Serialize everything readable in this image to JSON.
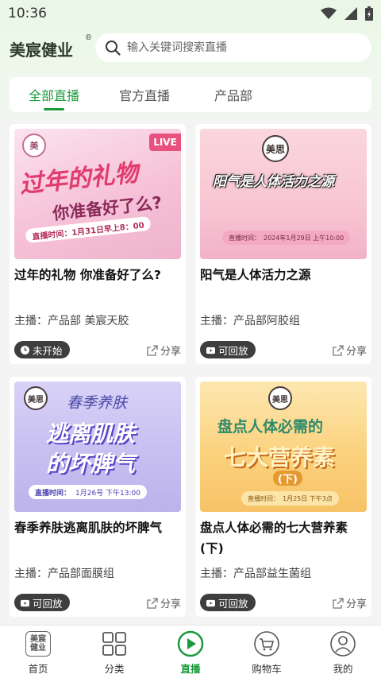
{
  "status_bar": {
    "time": "10:36"
  },
  "header": {
    "brand": "美宸健业",
    "brand_mark": "®",
    "search_placeholder": "输入关键词搜索直播"
  },
  "tabs": [
    {
      "label": "全部直播",
      "active": true
    },
    {
      "label": "官方直播",
      "active": false
    },
    {
      "label": "产品部",
      "active": false
    }
  ],
  "cards": [
    {
      "title": "过年的礼物 你准备好了么?",
      "host": "主播：产品部 美宸天胶",
      "status": "未开始",
      "share": "分享",
      "thumb": {
        "live_tag": "LIVE",
        "line1": "过年的礼物",
        "line2": "你准备好了么?",
        "schedule": "直播时间：1月31日早上8：00",
        "bg": "#f7cfe0"
      }
    },
    {
      "title": "阳气是人体活力之源",
      "host": "主播：产品部阿胶组",
      "status": "可回放",
      "share": "分享",
      "thumb": {
        "logo": "美思",
        "line1": "阳气是人体活力之源",
        "schedule_label": "直播时间：",
        "schedule": "2024年1月29日 上午10:00",
        "bg": "#f9cfda"
      }
    },
    {
      "title": "春季养肤逃离肌肤的坏脾气",
      "host": "主播：产品部面膜组",
      "status": "可回放",
      "share": "分享",
      "thumb": {
        "logo": "美思",
        "line0": "春季养肤",
        "line1": "逃离肌肤",
        "line2": "的坏脾气",
        "schedule_label": "直播时间：",
        "schedule": "1月26号 下午13:00",
        "bg": "#cfc6f3"
      }
    },
    {
      "title": "盘点人体必需的七大营养素(下)",
      "host": "主播：产品部益生菌组",
      "status": "可回放",
      "share": "分享",
      "thumb": {
        "logo": "美思",
        "line1": "盘点人体必需的",
        "line2": "七大营养素",
        "line3": "(下)",
        "schedule_label": "直播时间：",
        "schedule": "1月25日 下午3点",
        "bg": "#fbd98a"
      }
    }
  ],
  "bottom_nav": [
    {
      "label": "首页",
      "icon": "home-logo-icon",
      "logo_text": "美宸健业"
    },
    {
      "label": "分类",
      "icon": "grid-icon"
    },
    {
      "label": "直播",
      "icon": "play-circle-icon",
      "active": true
    },
    {
      "label": "购物车",
      "icon": "cart-icon"
    },
    {
      "label": "我的",
      "icon": "user-icon"
    }
  ],
  "colors": {
    "accent": "#1a9a3a",
    "badge_bg": "#3e3e3e"
  }
}
